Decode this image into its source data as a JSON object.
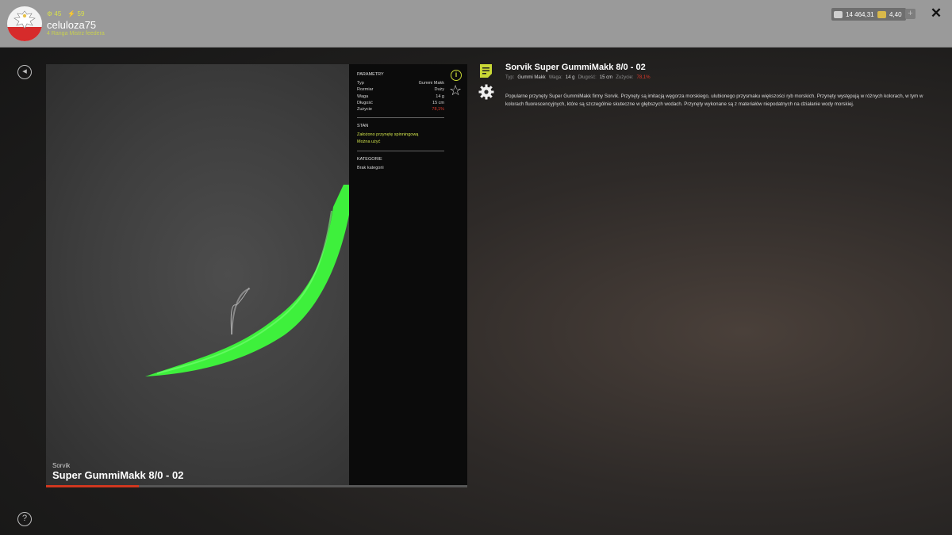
{
  "header": {
    "level": "45",
    "energy": "59",
    "username": "celuloza75",
    "rank": "4 Ranga Mistrz feedera",
    "currency1": "14 464,31",
    "currency2": "4,40",
    "plus": "+",
    "close": "✕"
  },
  "preview": {
    "brand": "Sorvik",
    "title": "Super GummiMakk 8/0 - 02",
    "progress": 0.22
  },
  "params": {
    "title": "PARAMETRY",
    "rows": [
      {
        "label": "Typ",
        "value": "Gummi Makk"
      },
      {
        "label": "Rozmiar",
        "value": "Duży"
      },
      {
        "label": "Waga",
        "value": "14 g"
      },
      {
        "label": "Długość",
        "value": "15 cm"
      },
      {
        "label": "Zużycie",
        "value": "78,1%"
      }
    ],
    "stan_title": "STAN",
    "stan_1": "Założono przynętę spinningową",
    "stan_2": "Można użyć",
    "kat_title": "KATEGORIE",
    "kat_1": "Brak kategorii"
  },
  "details": {
    "title": "Sorvik Super GummiMakk 8/0 - 02",
    "typ_label": "Typ:",
    "typ_value": "Gummi Makk",
    "waga_label": "Waga:",
    "waga_value": "14 g",
    "dlugosc_label": "Długość:",
    "dlugosc_value": "15 cm",
    "zuzycie_label": "Zużycie:",
    "zuzycie_value": "78,1%",
    "description": "Popularne przynęty Super GummiMakk firmy Sorvik. Przynęty są imitacją węgorza morskiego, ulubionego przysmaku większości ryb morskich. Przynęty występują w różnych kolorach, w tym w kolorach fluorescencyjnych, które są szczególnie skuteczne w głębszych wodach. Przynęty wykonane są z materiałów niepodatnych na działanie wody morskiej."
  },
  "icons": {
    "back": "back-icon",
    "help": "help-icon",
    "info": "info-icon",
    "star": "star-icon",
    "note": "note-icon",
    "gear": "gear-icon"
  },
  "colors": {
    "accent": "#c9d836",
    "lure": "#3ef03c",
    "wear": "#e0392b"
  }
}
